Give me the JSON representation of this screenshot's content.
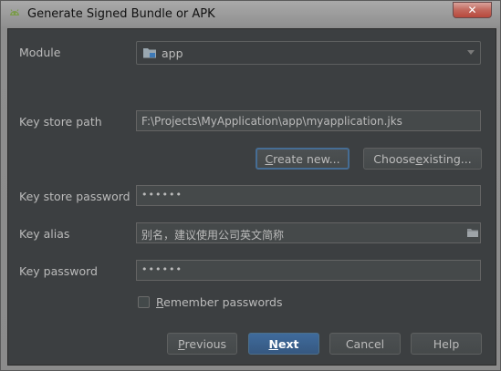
{
  "window": {
    "title": "Generate Signed Bundle or APK",
    "close_glyph": "✕"
  },
  "module": {
    "label": "Module",
    "selected": "app",
    "icon": "folder-module-icon"
  },
  "keystore": {
    "path_label": "Key store path",
    "path_value": "F:\\Projects\\MyApplication\\app\\myapplication.jks",
    "create_new_pre": "",
    "create_new_mnemonic": "C",
    "create_new_post": "reate new...",
    "choose_existing_pre": "Choose ",
    "choose_existing_mnemonic": "e",
    "choose_existing_post": "xisting...",
    "password_label": "Key store password",
    "password_value": "••••••"
  },
  "key": {
    "alias_label": "Key alias",
    "alias_value": "别名，建议使用公司英文简称",
    "alias_icon": "folder-browse-icon",
    "password_label": "Key password",
    "password_value": "••••••"
  },
  "remember": {
    "mnemonic": "R",
    "label_rest": "emember passwords",
    "checked": false
  },
  "buttons": {
    "previous_mnemonic": "P",
    "previous_rest": "revious",
    "next_mnemonic": "N",
    "next_rest": "ext",
    "cancel": "Cancel",
    "help": "Help"
  },
  "colors": {
    "background": "#3c3f41",
    "primary_button": "#365880",
    "text": "#bbbbbb"
  }
}
